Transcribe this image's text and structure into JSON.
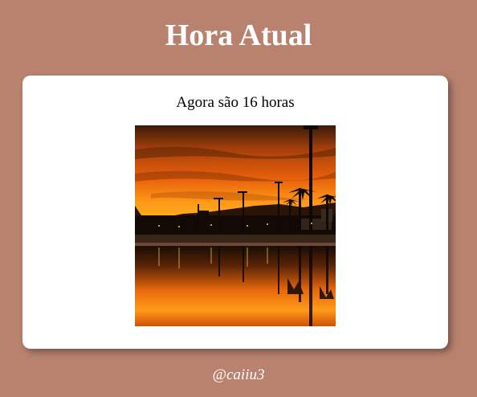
{
  "page": {
    "title": "Hora Atual",
    "background_color": "#b8826f"
  },
  "card": {
    "message": "Agora são 16 horas",
    "image": {
      "subject": "sunset-beach-photo",
      "colors": {
        "sky_top": "#3a1a0a",
        "sky_mid": "#e8600a",
        "horizon": "#ffb020",
        "silhouette": "#140a05",
        "water_reflection": "#ff8a10"
      }
    }
  },
  "footer": {
    "credit": "@caiiu3"
  }
}
